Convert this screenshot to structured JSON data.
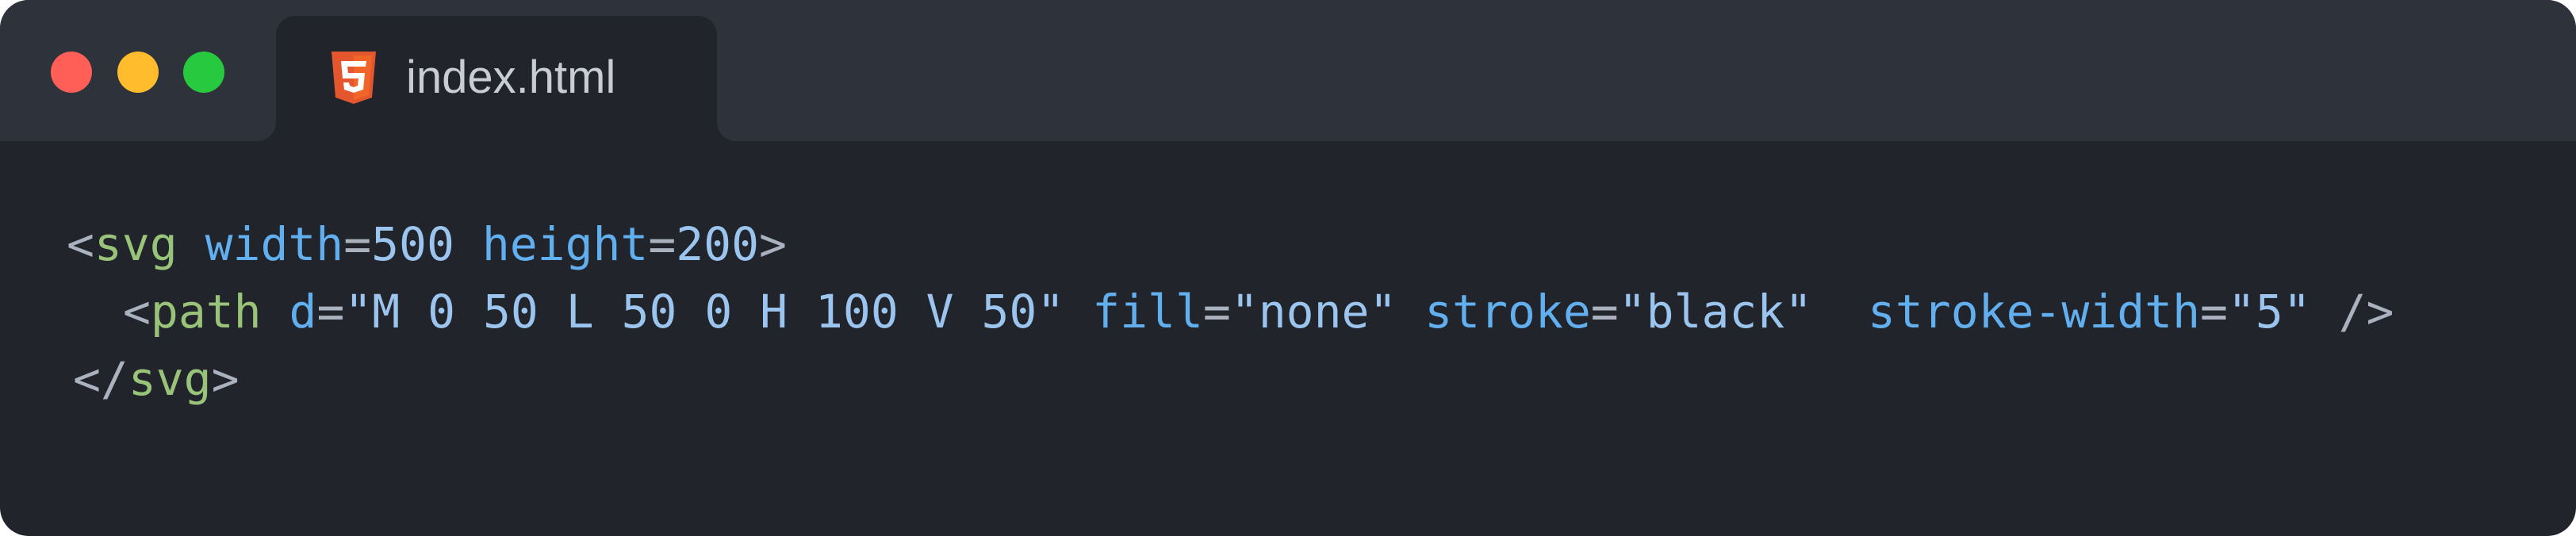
{
  "window": {
    "controls": [
      "close",
      "minimize",
      "maximize"
    ],
    "colors": {
      "close": "#ff5f56",
      "minimize": "#ffbd2e",
      "maximize": "#27c93f"
    }
  },
  "tab": {
    "icon": "html5-icon",
    "label": "index.html"
  },
  "code": {
    "line1": {
      "open": "<",
      "tag": "svg",
      "attr1": "width",
      "eq1": "=",
      "val1": "500",
      "attr2": "height",
      "eq2": "=",
      "val2": "200",
      "close": ">"
    },
    "line2": {
      "open": "<",
      "tag": "path",
      "attr1": "d",
      "eq1": "=",
      "val1": "\"M 0 50 L 50 0 H 100 V 50\"",
      "attr2": "fill",
      "eq2": "=",
      "val2": "\"none\"",
      "attr3": "stroke",
      "eq3": "=",
      "val3": "\"black\"",
      "attr4": "stroke-width",
      "eq4": "=",
      "val4": "\"5\"",
      "close": "/>"
    },
    "line3": {
      "open": "</",
      "tag": "svg",
      "close": ">"
    },
    "colors": {
      "punctuation": "#abb2bf",
      "tag": "#98c379",
      "attribute": "#61afef",
      "value": "#9bc5ef"
    }
  }
}
